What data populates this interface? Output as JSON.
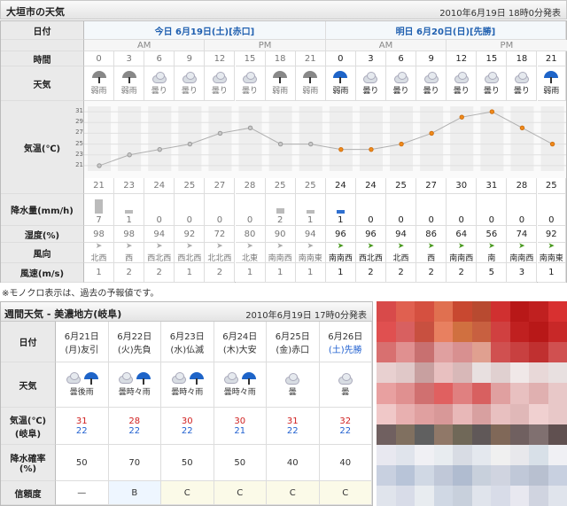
{
  "header": {
    "title": "大垣市の天気",
    "issued": "2010年6月19日 18時0分発表"
  },
  "labels": {
    "date": "日付",
    "time": "時間",
    "weather": "天気",
    "temp": "気温(℃)",
    "precip": "降水量(mm/h)",
    "humidity": "湿度(%)",
    "wind_dir": "風向",
    "wind_speed": "風速(m/s)"
  },
  "today": {
    "label": "今日 6月19日(土)[赤口]"
  },
  "tomorrow": {
    "label": "明日 6月20日(日)[先勝]"
  },
  "ampm": {
    "am": "AM",
    "pm": "PM"
  },
  "hours": [
    "0",
    "3",
    "6",
    "9",
    "12",
    "15",
    "18",
    "21",
    "0",
    "3",
    "6",
    "9",
    "12",
    "15",
    "18",
    "21"
  ],
  "weather": [
    "弱雨",
    "弱雨",
    "曇り",
    "曇り",
    "曇り",
    "曇り",
    "弱雨",
    "弱雨",
    "弱雨",
    "曇り",
    "曇り",
    "曇り",
    "曇り",
    "曇り",
    "曇り",
    "弱雨"
  ],
  "weather_icons": [
    "umbrella-gray",
    "umbrella-gray",
    "cloud",
    "cloud",
    "cloud",
    "cloud",
    "umbrella-gray",
    "umbrella-gray",
    "umbrella",
    "cloud",
    "cloud",
    "cloud",
    "cloud",
    "cloud",
    "cloud",
    "umbrella"
  ],
  "temp_axis": [
    "31",
    "29",
    "27",
    "25",
    "23",
    "21"
  ],
  "temps": [
    "21",
    "23",
    "24",
    "25",
    "27",
    "28",
    "25",
    "25",
    "24",
    "24",
    "25",
    "27",
    "30",
    "31",
    "28",
    "25"
  ],
  "precip": [
    "7",
    "1",
    "0",
    "0",
    "0",
    "0",
    "2",
    "1",
    "1",
    "0",
    "0",
    "0",
    "0",
    "0",
    "0",
    "0"
  ],
  "humidity": [
    "98",
    "98",
    "94",
    "92",
    "72",
    "80",
    "90",
    "94",
    "96",
    "96",
    "94",
    "86",
    "64",
    "56",
    "74",
    "92"
  ],
  "wind_dir": [
    "北西",
    "西",
    "西北西",
    "西北西",
    "北北西",
    "北東",
    "南南西",
    "南南東",
    "南南西",
    "西北西",
    "北西",
    "西",
    "南南西",
    "南",
    "南南西",
    "南南東"
  ],
  "wind_speed": [
    "1",
    "2",
    "2",
    "1",
    "2",
    "1",
    "1",
    "1",
    "1",
    "2",
    "2",
    "2",
    "2",
    "5",
    "3",
    "1"
  ],
  "chart_data": {
    "type": "line",
    "x": [
      "0",
      "3",
      "6",
      "9",
      "12",
      "15",
      "18",
      "21",
      "0",
      "3",
      "6",
      "9",
      "12",
      "15",
      "18",
      "21"
    ],
    "series": [
      {
        "values": [
          21,
          23,
          24,
          25,
          27,
          28,
          25,
          25,
          24,
          24,
          25,
          27,
          30,
          31,
          28,
          25
        ]
      }
    ],
    "ylim": [
      20,
      32
    ],
    "ticks": [
      21,
      23,
      25,
      27,
      29,
      31
    ]
  },
  "note": "※モノクロ表示は、過去の予報値です。",
  "weekly": {
    "title": "週間天気 - 美濃地方(岐阜)",
    "issued": "2010年6月19日 17時0分発表",
    "labels": {
      "date": "日付",
      "weather": "天気",
      "temp": "気温(℃)\n(岐阜)",
      "temp1": "気温(℃)",
      "temp2": "(岐阜)",
      "precip1": "降水確率",
      "precip2": "(%)",
      "reliability": "信頼度"
    },
    "days": [
      {
        "d1": "6月21日",
        "d2": "(月)友引",
        "wx": "曇後雨",
        "hi": "31",
        "lo": "22",
        "pop": "50",
        "rel": "—"
      },
      {
        "d1": "6月22日",
        "d2": "(火)先負",
        "wx": "曇時々雨",
        "hi": "28",
        "lo": "22",
        "pop": "70",
        "rel": "B"
      },
      {
        "d1": "6月23日",
        "d2": "(水)仏滅",
        "wx": "曇時々雨",
        "hi": "30",
        "lo": "22",
        "pop": "50",
        "rel": "C"
      },
      {
        "d1": "6月24日",
        "d2": "(木)大安",
        "wx": "曇時々雨",
        "hi": "30",
        "lo": "21",
        "pop": "50",
        "rel": "C"
      },
      {
        "d1": "6月25日",
        "d2": "(金)赤口",
        "wx": "曇",
        "hi": "31",
        "lo": "22",
        "pop": "40",
        "rel": "C"
      },
      {
        "d1": "6月26日",
        "d2": "(土)先勝",
        "wx": "曇",
        "hi": "32",
        "lo": "22",
        "pop": "40",
        "rel": "C"
      }
    ]
  },
  "mosaic_colors": [
    "#d84a4a",
    "#e06050",
    "#d55040",
    "#e07050",
    "#c84830",
    "#b84a30",
    "#d03030",
    "#b81818",
    "#c02020",
    "#d83030",
    "#e05050",
    "#d86060",
    "#c85040",
    "#e88060",
    "#d07040",
    "#c86040",
    "#d04040",
    "#c02020",
    "#b81818",
    "#c82828",
    "#d87070",
    "#e09090",
    "#c87070",
    "#e0a0a0",
    "#d89090",
    "#e0a090",
    "#d05050",
    "#c84040",
    "#c03030",
    "#d05050",
    "#e8d0d0",
    "#e0c8c8",
    "#c8a0a0",
    "#e8c0c0",
    "#d8b8b8",
    "#e8e0e0",
    "#e0d0d0",
    "#f0e8e8",
    "#e8d8d8",
    "#e8e0e0",
    "#e8a0a0",
    "#e09090",
    "#d07070",
    "#e06060",
    "#e08080",
    "#d86060",
    "#e0a0a0",
    "#e8c0c0",
    "#e0b0b0",
    "#e8c8c8",
    "#f0c8c8",
    "#e8b0b0",
    "#e0a0a0",
    "#d89898",
    "#e8b8b8",
    "#d8a0a0",
    "#e8c0c0",
    "#e0b8b8",
    "#f0d0d0",
    "#e8c8c8",
    "#706060",
    "#807060",
    "#606060",
    "#907868",
    "#706858",
    "#605858",
    "#806858",
    "#706060",
    "#807070",
    "#605050",
    "#e8e8f0",
    "#e0e4ec",
    "#f0f0f4",
    "#e8ecf0",
    "#d8dce4",
    "#e4e8ee",
    "#f0f0f0",
    "#e8e8ec",
    "#d8e0e8",
    "#f0f0f4",
    "#c8d0e0",
    "#b8c4d8",
    "#d0d8e4",
    "#c0c8d8",
    "#b0bcd0",
    "#c8d0dc",
    "#d0d4e0",
    "#c0c8d8",
    "#b8c0d0",
    "#c8d0e0",
    "#e0e4ec",
    "#d8dce8",
    "#e8ecf0",
    "#d0d8e4",
    "#c8d0dc",
    "#e0e4ec",
    "#d8dce8",
    "#e8e8f0",
    "#d0d4e0",
    "#e0e4ec"
  ]
}
